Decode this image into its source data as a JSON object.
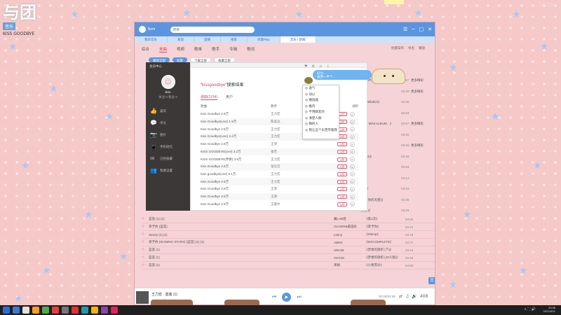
{
  "overlay": {
    "logo_big": "与团",
    "logo_tag": "音乐",
    "logo_sub": "KISS GOODBYE",
    "corner_label": "⬚⬚⬚⬚"
  },
  "window": {
    "user": "Bom",
    "search_value": "搜索",
    "nav": [
      "我的音乐",
      "发现",
      "直播",
      "搜索",
      "听歌Play",
      "音乐 / 新闻"
    ],
    "tabs": [
      "综合",
      "单曲",
      "视频",
      "歌单",
      "歌手",
      "专辑",
      "歌词"
    ],
    "tools": [
      "批量操作",
      "导出",
      "播放"
    ],
    "action_buttons": [
      "播放全部",
      "批量",
      "下载全部",
      "收藏全部"
    ],
    "tb_icons": [
      "☰",
      "─",
      "□",
      "✕"
    ]
  },
  "background_songs": [
    {
      "title": "蓝莲 (1) (1)",
      "artist": "翼LAB组",
      "album": "《第1次》",
      "dur": "04:05"
    },
    {
      "title": "寄予你 (蓝莲)",
      "artist": "OLIVER&森田彩",
      "album": "《寄予你》",
      "dur": "04:21"
    },
    {
      "title": "Stamp (1) (1)",
      "artist": "Litany",
      "album": "《Stamp》",
      "dur": "03:19"
    },
    {
      "title": "寄予你 (SHINING STARS) (蓝莲) (1) (1)",
      "artist": "AB6IX",
      "album": "《6IXCOMPLETE》",
      "dur": "03:47"
    },
    {
      "title": "蓝莲 (1)",
      "artist": "SNH48",
      "album": "《梦想的旗帜 (下)》",
      "dur": "03:44"
    },
    {
      "title": "蓝莲 (1)",
      "artist": "CKG48",
      "album": "《梦想的旗帜 (10人版)》",
      "dur": "03:45"
    },
    {
      "title": "蓝莲 (1)",
      "artist": "楽秘",
      "album": "《小楽苏达》",
      "dur": "04:05"
    }
  ],
  "right_column": [
    {
      "text": "(K-POP系列)",
      "dur": "03:57",
      "more": "更多精彩"
    },
    {
      "text": "",
      "dur": "03:48",
      "more": "更多精彩"
    },
    {
      "text": "constellation》",
      "dur": "03:36",
      "more": ""
    },
    {
      "text": "",
      "dur": "03:53",
      "more": ""
    },
    {
      "text": "4 AM MINI ALBUM…》",
      "dur": "03:57",
      "more": "更多精彩"
    },
    {
      "text": "",
      "dur": "03:45",
      "more": ""
    },
    {
      "text": "",
      "dur": "03:48",
      "more": "更多精彩"
    },
    {
      "text": "(elight)》",
      "dur": "03:45",
      "more": ""
    },
    {
      "text": "",
      "dur": "03:53",
      "more": ""
    },
    {
      "text": "",
      "dur": "03:14",
      "more": ""
    },
    {
      "text": "eng)》",
      "dur": "03:15",
      "more": ""
    },
    {
      "text": "(正在你的天使)》",
      "dur": "03:36",
      "more": ""
    },
    {
      "text": "天(长)》",
      "dur": "03:26",
      "more": ""
    }
  ],
  "sidebar": {
    "title": "会员中心",
    "name": "Bee",
    "stats": "关注 0   粉丝 0",
    "menu": [
      {
        "icon": "thumb-up-icon",
        "glyph": "👍",
        "label": "喜欢"
      },
      {
        "icon": "chat-icon",
        "glyph": "💬",
        "label": "评论"
      },
      {
        "icon": "camera-icon",
        "glyph": "📷",
        "label": "图片"
      },
      {
        "icon": "device-icon",
        "glyph": "📱",
        "label": "手机短信"
      },
      {
        "icon": "mail-icon",
        "glyph": "✉",
        "label": "已经收藏"
      },
      {
        "icon": "group-icon",
        "glyph": "👥",
        "label": "我要设置"
      }
    ]
  },
  "results": {
    "title_prefix": "“",
    "keyword": "kissgoodbye",
    "title_suffix": "”搜索结果",
    "tabs": [
      "歌曲(1154)",
      "用户"
    ],
    "headers": [
      "歌曲",
      "歌手",
      "试听"
    ],
    "like_label": "3首",
    "rows": [
      {
        "title": "Kiss Goodbye 2.9万",
        "artist": "王力宏"
      },
      {
        "title": "Kiss Goodbye(Live) 1.9万",
        "artist": "陈奕迅"
      },
      {
        "title": "Kiss Goodbye 2.9万",
        "artist": "王力宏"
      },
      {
        "title": "Kiss Goodbye(Live) 2.4万",
        "artist": "王力宏"
      },
      {
        "title": "Kiss Goodbye 2.9万",
        "artist": "王菲"
      },
      {
        "title": "KISS GOODBYE(Live) 3.2万",
        "artist": "张杰"
      },
      {
        "title": "KISS GOODBYE(伴奏) 3.9万",
        "artist": "王力宏"
      },
      {
        "title": "Kiss Goodbye 2.9万",
        "artist": "张信哲"
      },
      {
        "title": "Kiss goodbye(Live) 5.1万",
        "artist": "王力宏"
      },
      {
        "title": "Kiss Goodbye 3.9万",
        "artist": "王力宏"
      },
      {
        "title": "Kiss Goodbye 3.9万",
        "artist": "王菲"
      },
      {
        "title": "Kiss Goodbye 3.9万",
        "artist": "王源"
      },
      {
        "title": "Kiss Goodbye 2.9万",
        "artist": "王嘉尔"
      }
    ]
  },
  "dropdown": {
    "header_icons": [
      "♥",
      "⚙",
      "⚠",
      "↓"
    ],
    "items": [
      "送气",
      "动以",
      "播放器",
      "推鸡",
      "不用聊友的",
      "清楚人群",
      "确的人",
      "我让这个东西带着我"
    ]
  },
  "chat": {
    "user": "好力",
    "message": "收到一半个…"
  },
  "player": {
    "song": "王力宏 - 蓝莲 (1)",
    "icons": "♡ ⤓ ⋯ ♫",
    "controls": [
      "⏮",
      "▶",
      "⏭"
    ],
    "time": "00:00/03:58",
    "right": [
      "⇄",
      "♫",
      "🔊",
      "408"
    ]
  },
  "fab_glyph": "☰",
  "taskbar": {
    "apps": [
      "#3a7bd5",
      "#e3e3e3",
      "#ff9e2c",
      "#4cae4c",
      "#e54040",
      "#777",
      "#d33",
      "#29a",
      "#ffb300",
      "#8e44ad",
      "#e91e63"
    ],
    "tray": "∧ ⛶ 🔊",
    "time": "20:06",
    "date": "2021/8/11"
  }
}
